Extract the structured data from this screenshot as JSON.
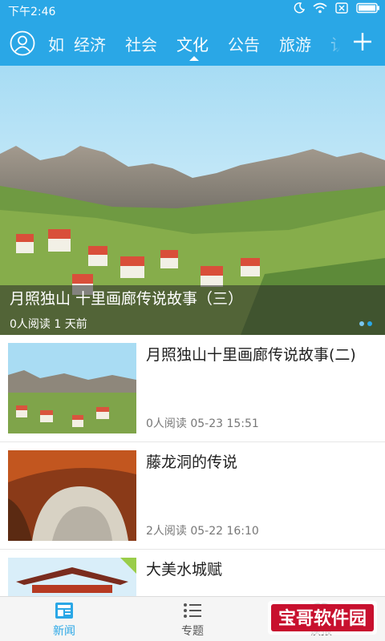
{
  "status_bar": {
    "time": "下午2:46"
  },
  "nav": {
    "tabs": [
      {
        "label": "如"
      },
      {
        "label": "经济"
      },
      {
        "label": "社会"
      },
      {
        "label": "文化"
      },
      {
        "label": "公告"
      },
      {
        "label": "旅游"
      },
      {
        "label": "认"
      }
    ],
    "active_tab": "文化",
    "accent_color": "#2aa7e6"
  },
  "hero": {
    "title": "月照独山 十里画廊传说故事（三）",
    "meta": "0人阅读  1 天前",
    "dots": 2,
    "active_dot": 1
  },
  "articles": [
    {
      "title": "月照独山十里画廊传说故事(二)",
      "meta": "0人阅读    05-23 15:51"
    },
    {
      "title": "藤龙洞的传说",
      "meta": "2人阅读    05-22 16:10"
    },
    {
      "title": "大美水城赋",
      "meta": ""
    }
  ],
  "bottom_tabs": [
    {
      "label": "新闻",
      "icon": "newspaper-icon"
    },
    {
      "label": "专题",
      "icon": "list-icon"
    },
    {
      "label": "读报",
      "icon": "paper-icon"
    }
  ],
  "watermark": {
    "text": "宝哥软件园"
  }
}
